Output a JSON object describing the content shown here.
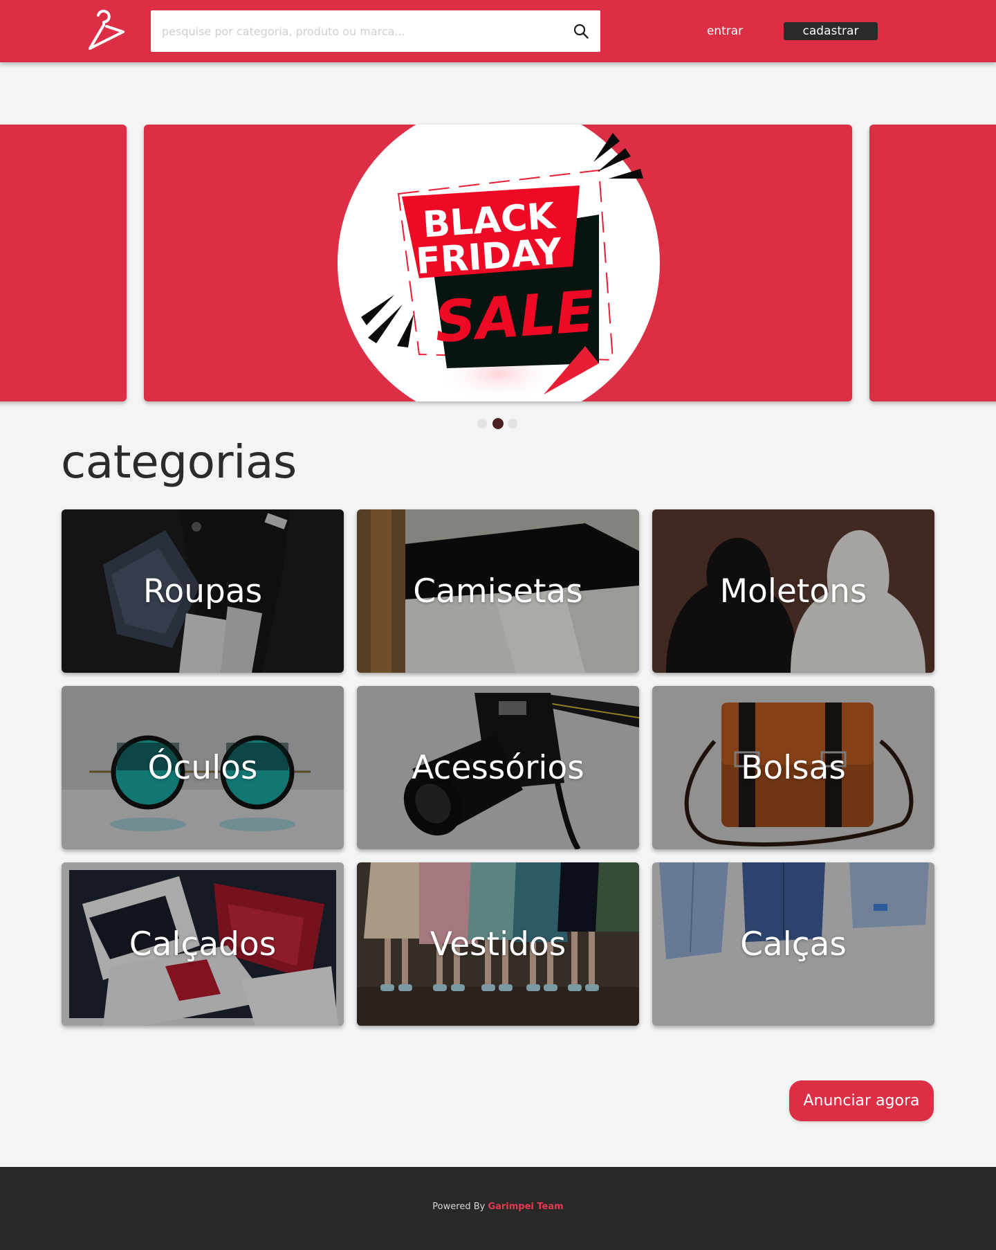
{
  "header": {
    "logo_icon": "hanger-icon",
    "search": {
      "placeholder": "pesquise por categoria, produto ou marca...",
      "value": "",
      "icon": "search-icon"
    },
    "login_label": "entrar",
    "signup_label": "cadastrar"
  },
  "carousel": {
    "banner": {
      "line1": "BLACK",
      "line2": "FRIDAY",
      "line3": "SALE"
    },
    "dots": 3,
    "active_index": 1
  },
  "categories": {
    "title": "categorias",
    "items": [
      {
        "label": "Roupas"
      },
      {
        "label": "Camisetas"
      },
      {
        "label": "Moletons"
      },
      {
        "label": "Óculos"
      },
      {
        "label": "Acessórios"
      },
      {
        "label": "Bolsas"
      },
      {
        "label": "Calçados"
      },
      {
        "label": "Vestidos"
      },
      {
        "label": "Calças"
      }
    ]
  },
  "cta": {
    "label": "Anunciar agora"
  },
  "footer": {
    "prefix": "Powered By ",
    "brand": "Garimpei Team"
  },
  "colors": {
    "brand_red": "#dc2e44",
    "header_button_dark": "#2a2a2a",
    "background": "#f4f4f4",
    "footer_bg": "#282828",
    "footer_brand": "#e33a50"
  }
}
